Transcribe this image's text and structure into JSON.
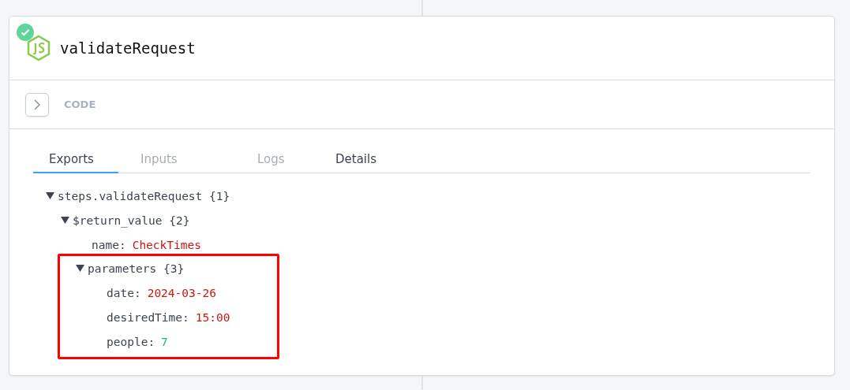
{
  "step": {
    "title": "validateRequest",
    "succeeded": true
  },
  "code_section": {
    "label": "CODE",
    "expanded": false
  },
  "tabs": [
    {
      "label": "Exports",
      "selected": true,
      "disabled": false
    },
    {
      "label": "Inputs",
      "selected": false,
      "disabled": true
    },
    {
      "label": "Logs",
      "selected": false,
      "disabled": true
    },
    {
      "label": "Details",
      "selected": false,
      "disabled": false
    }
  ],
  "tree": [
    {
      "key": "steps.validateRequest",
      "count": "{1}",
      "expanded": true,
      "highlighted": false,
      "children": [
        {
          "key": "$return_value",
          "count": "{2}",
          "expanded": true,
          "highlighted": false,
          "children": [
            {
              "key": "name:",
              "value": "CheckTimes",
              "kind": "string"
            },
            {
              "key": "parameters",
              "count": "{3}",
              "expanded": true,
              "highlighted": true,
              "children": [
                {
                  "key": "date:",
                  "value": "2024-03-26",
                  "kind": "string"
                },
                {
                  "key": "desiredTime:",
                  "value": "15:00",
                  "kind": "string"
                },
                {
                  "key": "people:",
                  "value": "7",
                  "kind": "number"
                }
              ]
            }
          ]
        }
      ]
    }
  ]
}
